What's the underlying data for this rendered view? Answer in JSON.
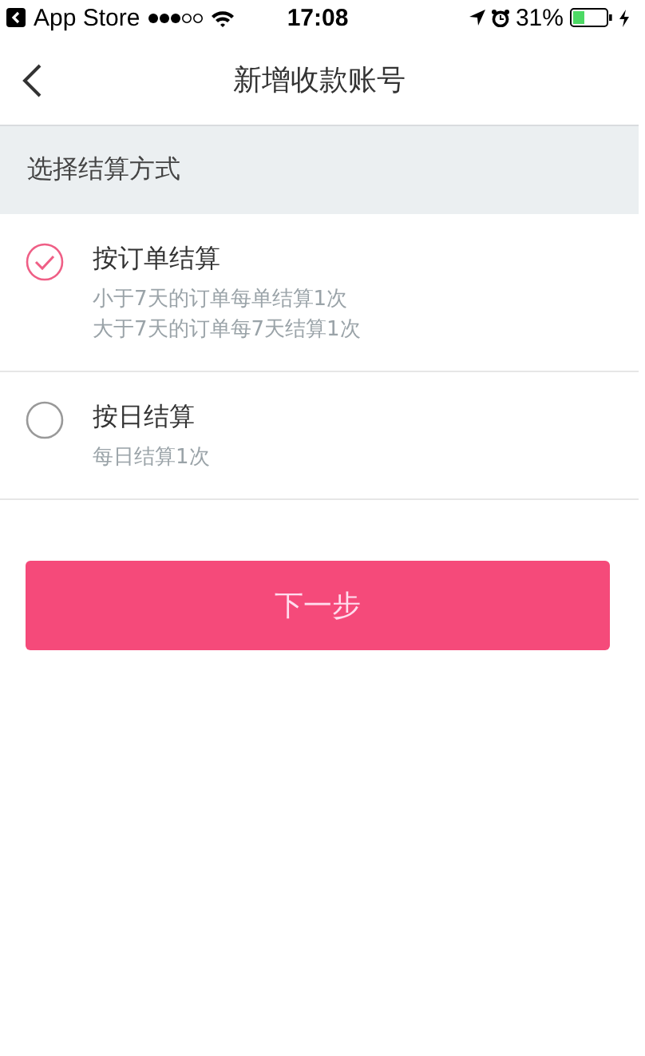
{
  "status_bar": {
    "back_app": "App Store",
    "time": "17:08",
    "battery": "31%"
  },
  "nav": {
    "title": "新增收款账号"
  },
  "section": {
    "title": "选择结算方式"
  },
  "options": [
    {
      "label": "按订单结算",
      "selected": true,
      "lines": [
        "小于7天的订单每单结算1次",
        "大于7天的订单每7天结算1次"
      ]
    },
    {
      "label": "按日结算",
      "selected": false,
      "lines": [
        "每日结算1次"
      ]
    }
  ],
  "button": {
    "label": "下一步"
  }
}
